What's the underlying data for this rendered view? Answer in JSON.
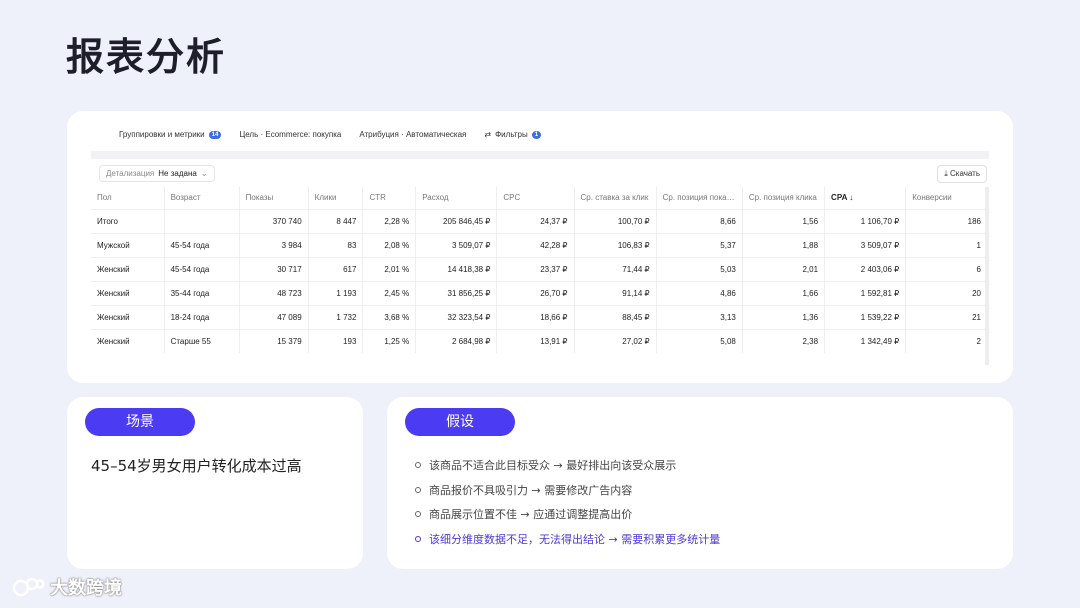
{
  "page": {
    "title": "报表分析"
  },
  "toolbar": {
    "grouping_label": "Группировки и метрики",
    "grouping_count": "14",
    "goal_label": "Цель · Ecommerce: покупка",
    "attribution_label": "Атрибуция · Автоматическая",
    "filters_label": "Фильтры",
    "filters_count": "1"
  },
  "detail": {
    "label": "Детализация",
    "value": "Не задана"
  },
  "download": {
    "label": "Скачать"
  },
  "table": {
    "headers": [
      "Пол",
      "Возраст",
      "Показы",
      "Клики",
      "CTR",
      "Расход",
      "CPC",
      "Ср. ставка за клик",
      "Ср. позиция пока…",
      "Ср. позиция клика",
      "CPA ↓",
      "Конверсии"
    ],
    "rows": [
      [
        "Итого",
        "",
        "370 740",
        "8 447",
        "2,28 %",
        "205 846,45 ₽",
        "24,37 ₽",
        "100,70 ₽",
        "8,66",
        "1,56",
        "1 106,70 ₽",
        "186"
      ],
      [
        "Мужской",
        "45-54 года",
        "3 984",
        "83",
        "2,08 %",
        "3 509,07 ₽",
        "42,28 ₽",
        "106,83 ₽",
        "5,37",
        "1,88",
        "3 509,07 ₽",
        "1"
      ],
      [
        "Женский",
        "45-54 года",
        "30 717",
        "617",
        "2,01 %",
        "14 418,38 ₽",
        "23,37 ₽",
        "71,44 ₽",
        "5,03",
        "2,01",
        "2 403,06 ₽",
        "6"
      ],
      [
        "Женский",
        "35-44 года",
        "48 723",
        "1 193",
        "2,45 %",
        "31 856,25 ₽",
        "26,70 ₽",
        "91,14 ₽",
        "4,86",
        "1,66",
        "1 592,81 ₽",
        "20"
      ],
      [
        "Женский",
        "18-24 года",
        "47 089",
        "1 732",
        "3,68 %",
        "32 323,54 ₽",
        "18,66 ₽",
        "88,45 ₽",
        "3,13",
        "1,36",
        "1 539,22 ₽",
        "21"
      ],
      [
        "Женский",
        "Старше 55",
        "15 379",
        "193",
        "1,25 %",
        "2 684,98 ₽",
        "13,91 ₽",
        "27,02 ₽",
        "5,08",
        "2,38",
        "1 342,49 ₽",
        "2"
      ]
    ]
  },
  "scene": {
    "pill": "场景",
    "text": "45–54岁男女用户转化成本过高"
  },
  "hypothesis": {
    "pill": "假设",
    "items": [
      "该商品不适合此目标受众 → 最好排出向该受众展示",
      "商品报价不具吸引力 → 需要修改广告内容",
      "商品展示位置不佳 → 应通过调整提高出价",
      "该细分维度数据不足，无法得出结论 → 需要积累更多统计量"
    ]
  },
  "watermark": {
    "text": "大数跨境"
  }
}
